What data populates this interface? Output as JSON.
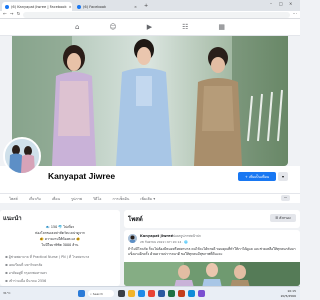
{
  "browser": {
    "tabs": [
      {
        "label": "(6) Kanyapat Jiwree | Facebook",
        "close": "×"
      },
      {
        "label": "(6) Facebook",
        "close": "×"
      }
    ],
    "new_tab": "+",
    "window_controls": [
      "–",
      "□",
      "×"
    ],
    "nav_icons": [
      "back-icon",
      "forward-icon",
      "reload-icon"
    ]
  },
  "fb_nav": [
    {
      "name": "nav-home",
      "icon": "⌂"
    },
    {
      "name": "nav-friends",
      "icon": "☺"
    },
    {
      "name": "nav-watch",
      "icon": "▶"
    },
    {
      "name": "nav-groups",
      "icon": "☷"
    },
    {
      "name": "nav-gaming",
      "icon": "▦"
    }
  ],
  "profile": {
    "name": "Kanyapat Jiwree",
    "add_story_label": "เพิ่มเป็นเพื่อน",
    "add_icon": "+",
    "more_icon": "▾",
    "tabs": [
      "โพสต์",
      "เกี่ยวกับ",
      "เพื่อน",
      "รูปภาพ",
      "วิดีโอ",
      "การเช็คอิน",
      "เพิ่มเติม ▾"
    ],
    "tabs_dots": "···"
  },
  "intro": {
    "title": "แนะนำ",
    "lines": [
      "🐟 150 🐬 ไปเที่ยว",
      "ท่องโลกของเหล่าสัตว์ทะเลน่าดูจาก",
      "🐠 ความงามใต้ท้องทะเล 🐠",
      "ไม่มีใจมาพิชิต 3000 ล้าน"
    ],
    "detail_lines": [
      "ผู้ช่วยพยาบาล ที่ Practical Nurse ( PN ) ที่ โรงพยาบาล",
      "เคยเรียนที่ มหาวิทยาลัย",
      "อาศัยอยู่ที่ กรุงเทพมหานคร",
      "เข้าร่วมเมื่อ มีนาคม 2556"
    ]
  },
  "posts": {
    "title": "โพสต์",
    "filter_label": "ตัวกรอง",
    "post": {
      "author": "Kanyapat Jiwree",
      "action": "อัปเดตรูปภาพหน้าปก",
      "date": "28 กันยายน 2022 เวลา 20:14 · 🌐",
      "text": "ถ้าไม่มีโรคภัย ก็จะไม่ต้องมีหมอหรือพยาบาล คนไข้จะได้หายดี ขอบคุณที่ทำให้เราได้ดูแล และช่วยเหลือให้ทุกคนกลับมาแข็งแรงอีกครั้ง ด้วยความปรารถนาดี ขอให้ทุกคนมีสุขภาพที่ดีนะคะ"
    }
  },
  "taskbar": {
    "weather": "31°C",
    "search_label": "Search",
    "time": "10:15",
    "date": "20/5/2566"
  },
  "colors": {
    "fb_blue": "#1877f2",
    "page_bg": "#f0f2f5"
  }
}
